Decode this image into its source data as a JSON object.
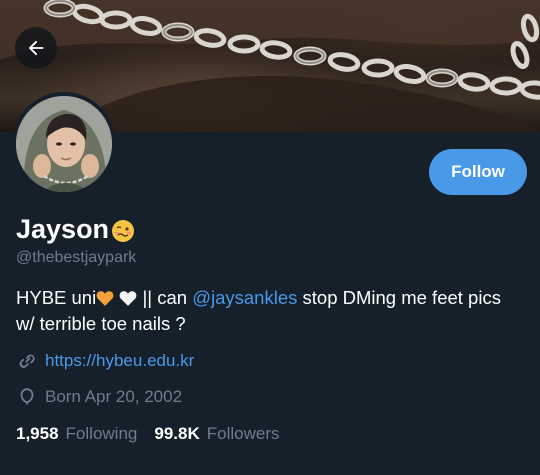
{
  "header": {
    "back_icon": "arrow-left-icon"
  },
  "profile": {
    "display_name": "Jayson",
    "name_emoji": "woozy-face",
    "handle": "@thebestjaypark",
    "follow_label": "Follow",
    "bio": {
      "part1": "HYBE uni",
      "part2": " || can ",
      "mention": "@jaysankles",
      "part3": " stop DMing me feet pics w/ terrible toe nails ?"
    },
    "link_text": "https://hybeu.edu.kr",
    "born_text": "Born Apr 20, 2002",
    "following_count": "1,958",
    "following_label": "Following",
    "followers_count": "99.8K",
    "followers_label": "Followers"
  },
  "colors": {
    "background": "#15202b",
    "accent": "#4a99e9",
    "secondary_text": "#6e7c8c"
  }
}
